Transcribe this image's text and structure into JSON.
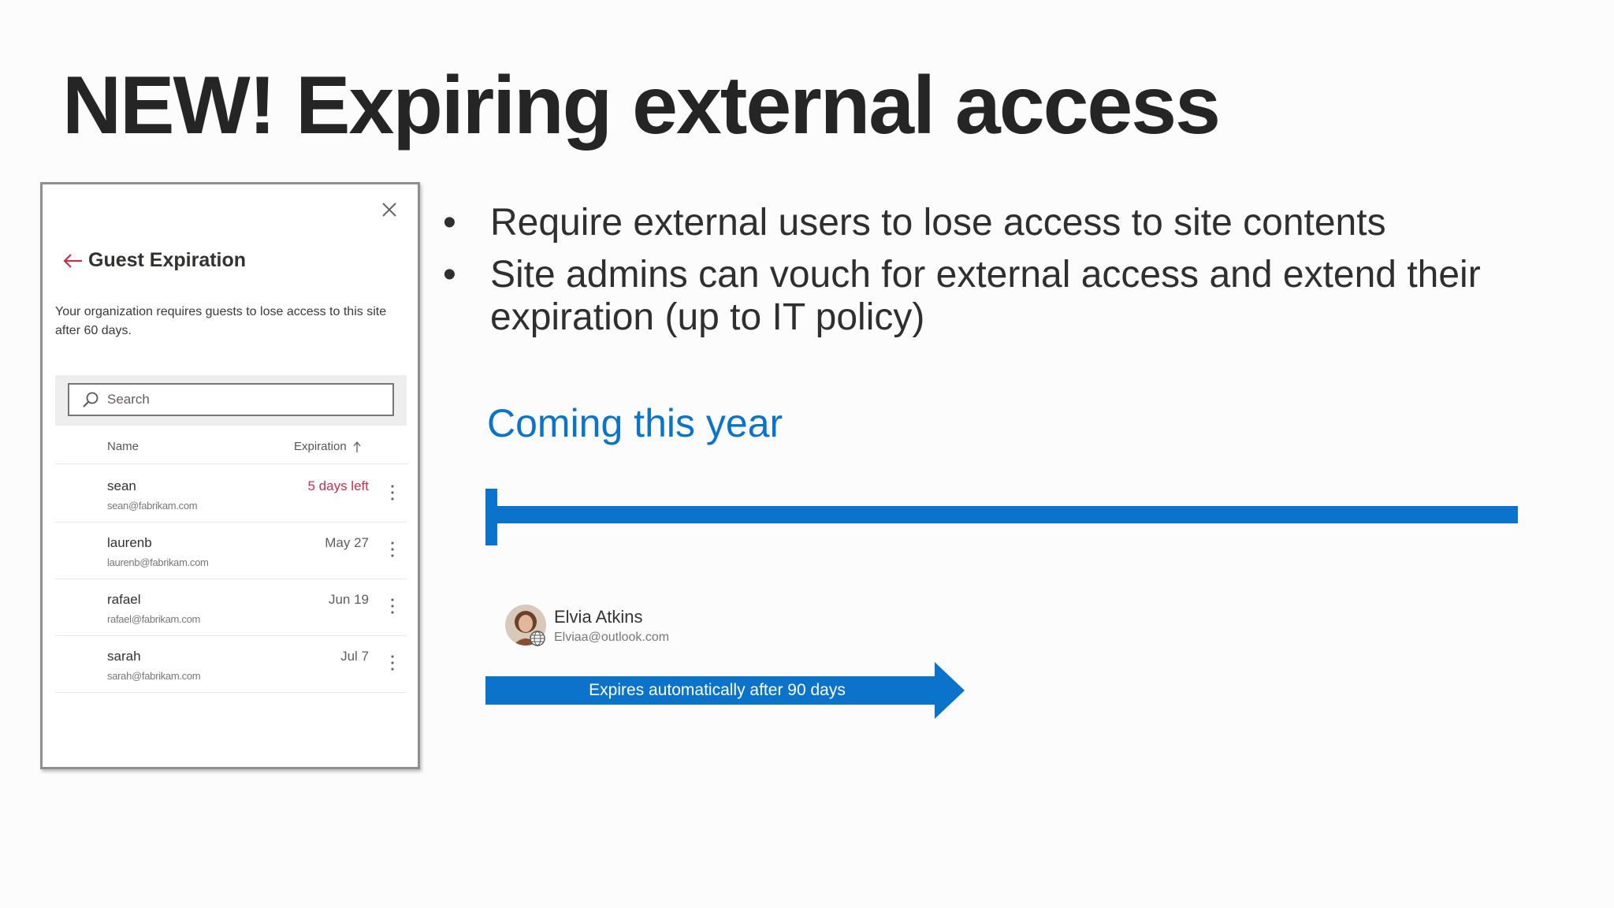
{
  "slide": {
    "title": "NEW! Expiring external access"
  },
  "panel": {
    "title": "Guest Expiration",
    "description": "Your organization requires guests to lose access to this site after 60 days.",
    "search_placeholder": "Search",
    "columns": {
      "name": "Name",
      "expiration": "Expiration"
    },
    "rows": [
      {
        "name": "sean",
        "email": "sean@fabrikam.com",
        "expiration": "5 days left",
        "warning": true
      },
      {
        "name": "laurenb",
        "email": "laurenb@fabrikam.com",
        "expiration": "May 27",
        "warning": false
      },
      {
        "name": "rafael",
        "email": "rafael@fabrikam.com",
        "expiration": "Jun 19",
        "warning": false
      },
      {
        "name": "sarah",
        "email": "sarah@fabrikam.com",
        "expiration": "Jul 7",
        "warning": false
      }
    ]
  },
  "bullets": [
    "Require external users to lose access to site contents",
    "Site admins can vouch for external access and extend their expiration (up to IT policy)"
  ],
  "coming_label": "Coming this year",
  "guest": {
    "name": "Elvia Atkins",
    "email": "Elviaa@outlook.com"
  },
  "arrow_label": "Expires automatically after 90 days",
  "colors": {
    "accent_blue": "#0b73c9",
    "warning_red": "#c4314b",
    "title_text": "#252525"
  },
  "icons": [
    "close-icon",
    "back-arrow-icon",
    "search-icon",
    "sort-ascending-icon",
    "more-vertical-icon",
    "guest-globe-icon"
  ]
}
